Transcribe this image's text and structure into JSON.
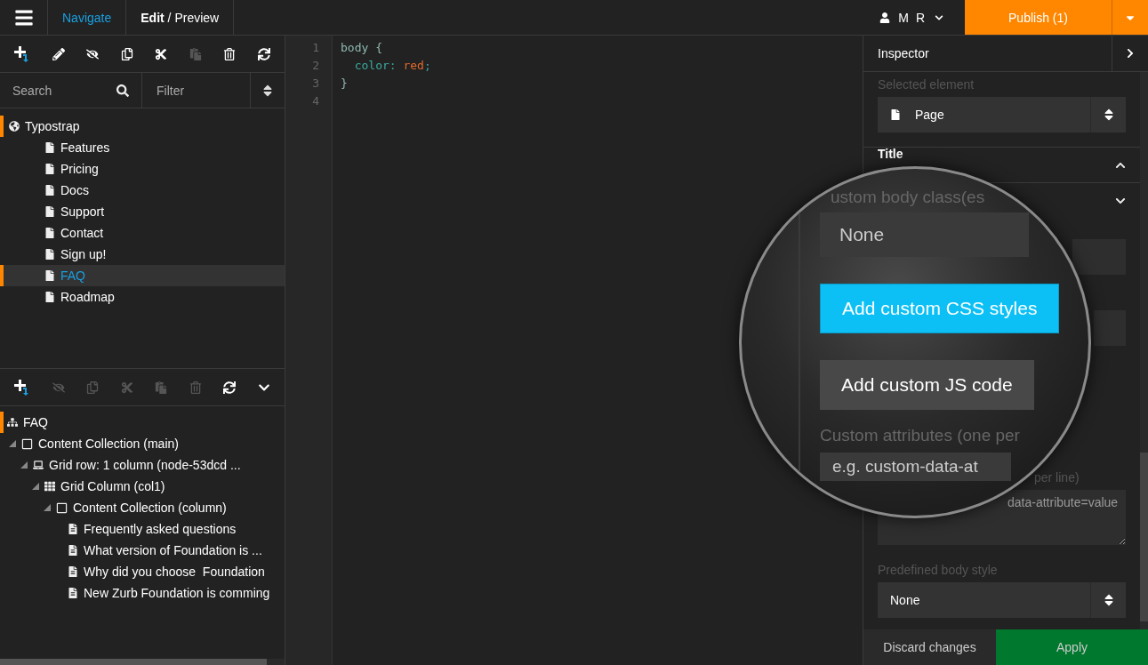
{
  "topbar": {
    "tabs": [
      {
        "label": "Navigate",
        "selected": true
      },
      {
        "label": "**Edit** / Preview",
        "selected": false
      }
    ],
    "user": "M R",
    "publish": "Publish (1)"
  },
  "left": {
    "toolbar": [
      {
        "kind": "add",
        "disabled": false
      },
      {
        "kind": "edit",
        "disabled": false
      },
      {
        "kind": "hide",
        "disabled": false
      },
      {
        "kind": "copy",
        "disabled": false
      },
      {
        "kind": "cut",
        "disabled": false
      },
      {
        "kind": "paste",
        "disabled": true
      },
      {
        "kind": "delete",
        "disabled": false
      },
      {
        "kind": "refresh",
        "disabled": false
      }
    ],
    "search": {
      "placeholder": "Search"
    },
    "filter": {
      "placeholder": "Filter"
    },
    "page_tree": [
      {
        "label": "Typostrap",
        "kind": "site",
        "marked": true,
        "selected": false,
        "children": [
          {
            "label": "Features",
            "kind": "page",
            "marked": false,
            "selected": false
          },
          {
            "label": "Pricing",
            "kind": "page",
            "marked": false,
            "selected": false
          },
          {
            "label": "Docs",
            "kind": "page",
            "marked": false,
            "selected": false
          },
          {
            "label": "Support",
            "kind": "page",
            "marked": false,
            "selected": false
          },
          {
            "label": "Contact",
            "kind": "page",
            "marked": false,
            "selected": false
          },
          {
            "label": "Sign up!",
            "kind": "page",
            "marked": false,
            "selected": false
          },
          {
            "label": "FAQ",
            "kind": "page",
            "marked": true,
            "selected": true
          },
          {
            "label": "Roadmap",
            "kind": "page",
            "marked": false,
            "selected": false
          }
        ]
      }
    ],
    "content_toolbar": [
      {
        "kind": "add",
        "disabled": false
      },
      {
        "kind": "hide",
        "disabled": true
      },
      {
        "kind": "copy",
        "disabled": true
      },
      {
        "kind": "cut",
        "disabled": true
      },
      {
        "kind": "paste",
        "disabled": true
      },
      {
        "kind": "delete",
        "disabled": true
      },
      {
        "kind": "refresh",
        "disabled": false
      },
      {
        "kind": "collapse",
        "disabled": false
      }
    ],
    "content_tree": [
      {
        "label": "FAQ",
        "kind": "sitemap",
        "marked": true,
        "children": [
          {
            "label": "Content Collection (main)",
            "kind": "collection",
            "expanded": true,
            "children": [
              {
                "label": "Grid row: 1 column (node-53dcd ...",
                "kind": "row",
                "expanded": true,
                "children": [
                  {
                    "label": "Grid Column (col1)",
                    "kind": "column",
                    "expanded": true,
                    "children": [
                      {
                        "label": "Content Collection (column)",
                        "kind": "collection",
                        "expanded": true,
                        "children": [
                          {
                            "label": "Frequently asked questions",
                            "kind": "doc"
                          },
                          {
                            "label": "What version of Foundation is ...",
                            "kind": "doc"
                          },
                          {
                            "label": "Why did you choose  Foundation",
                            "kind": "doc"
                          },
                          {
                            "label": "New Zurb Foundation is comming",
                            "kind": "doc"
                          }
                        ]
                      }
                    ]
                  }
                ]
              }
            ]
          }
        ]
      }
    ]
  },
  "editor": {
    "lines": [
      {
        "number": "1",
        "tokens": [
          {
            "text": "body {",
            "kind": "plain"
          }
        ]
      },
      {
        "number": "2",
        "tokens": [
          {
            "text": "  color: ",
            "kind": "property"
          },
          {
            "text": "red",
            "kind": "value"
          },
          {
            "text": ";",
            "kind": "property"
          }
        ]
      },
      {
        "number": "3",
        "tokens": [
          {
            "text": "}",
            "kind": "plain"
          }
        ]
      },
      {
        "number": "4"
      }
    ]
  },
  "inspector": {
    "title": "Inspector",
    "selected_element": {
      "label": "Selected element",
      "value": "Page"
    },
    "sections": [
      {
        "title": "Title",
        "expanded": true
      },
      {
        "expanded": false
      }
    ],
    "attributes_label": "per line)",
    "attributes_placeholder": "data-attribute=value",
    "body_style": {
      "label": "Predefined body style",
      "value": "None"
    },
    "discard": "Discard changes",
    "apply": "Apply"
  },
  "magnifier": {
    "class_label": "ustom body class(es",
    "class_value": "None",
    "buttons": [
      {
        "label": "Add custom CSS styles",
        "highlighted": true
      },
      {
        "label": "Add custom JS code",
        "highlighted": false
      }
    ],
    "attributes_label": "Custom attributes (one per",
    "attributes_value": "e.g. custom-data-at"
  }
}
